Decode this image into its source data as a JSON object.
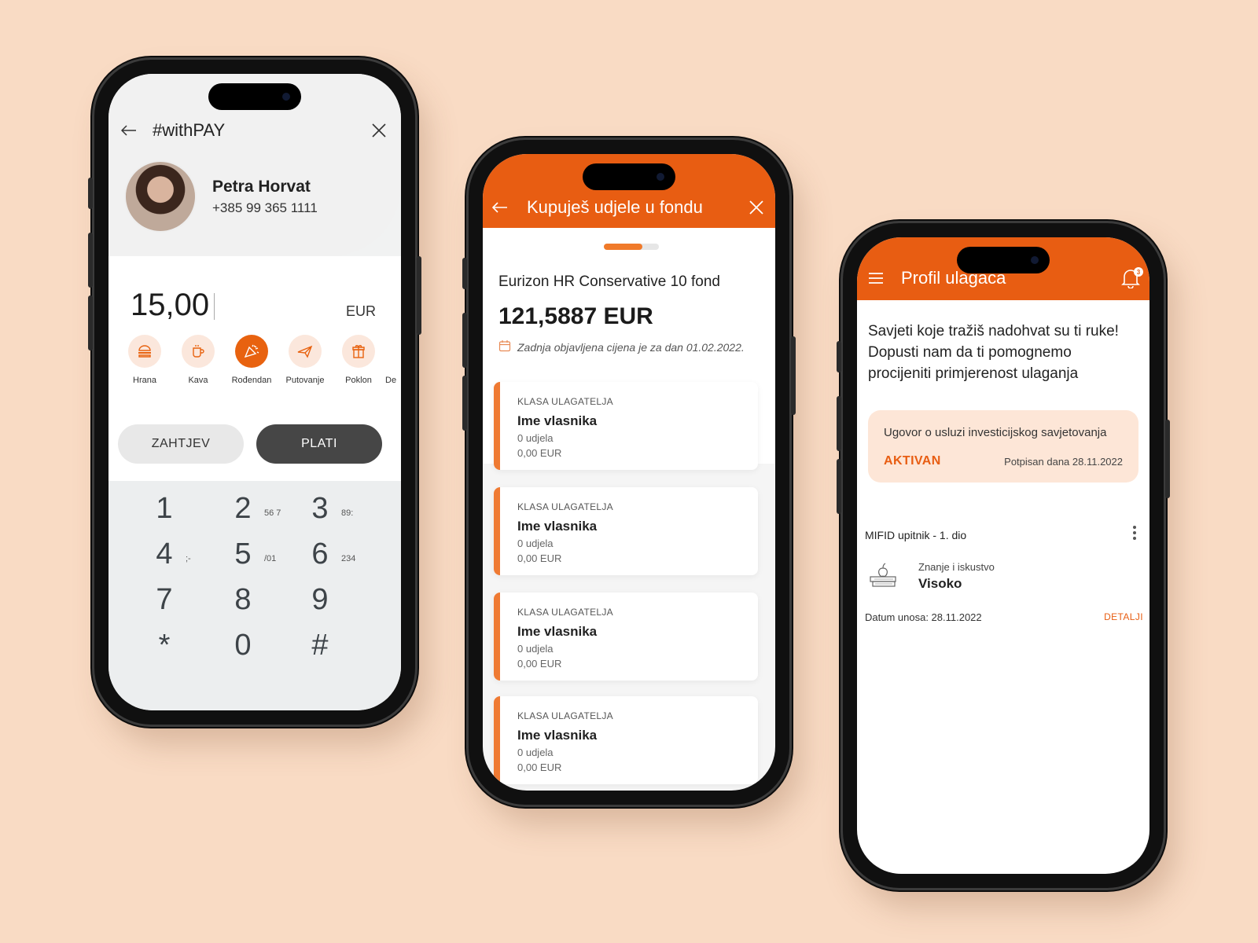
{
  "theme": {
    "accent": "#e85d12",
    "background": "#f9dbc4"
  },
  "phone1": {
    "title": "#withPAY",
    "back_icon": "arrow-left-icon",
    "close_icon": "close-icon",
    "contact": {
      "name": "Petra Horvat",
      "phone": "+385 99 365 1111"
    },
    "amount": "15,00",
    "currency": "EUR",
    "categories": [
      {
        "label": "Hrana",
        "icon": "food-icon",
        "active": false
      },
      {
        "label": "Kava",
        "icon": "coffee-icon",
        "active": false
      },
      {
        "label": "Rođendan",
        "icon": "party-icon",
        "active": true
      },
      {
        "label": "Putovanje",
        "icon": "plane-icon",
        "active": false
      },
      {
        "label": "Poklon",
        "icon": "gift-icon",
        "active": false
      },
      {
        "label": "De",
        "icon": "more-icon",
        "active": false
      }
    ],
    "request_label": "ZAHTJEV",
    "pay_label": "PLATI",
    "keys": [
      {
        "n": "1",
        "s": ""
      },
      {
        "n": "2",
        "s": "56 7"
      },
      {
        "n": "3",
        "s": "89:"
      },
      {
        "n": "4",
        "s": ";-"
      },
      {
        "n": "5",
        "s": "/01"
      },
      {
        "n": "6",
        "s": "234"
      },
      {
        "n": "7",
        "s": ""
      },
      {
        "n": "8",
        "s": ""
      },
      {
        "n": "9",
        "s": ""
      },
      {
        "n": "*",
        "s": ""
      },
      {
        "n": "0",
        "s": ""
      },
      {
        "n": "#",
        "s": ""
      }
    ]
  },
  "phone2": {
    "title": "Kupuješ udjele u fondu",
    "progress": 0.7,
    "fund_name": "Eurizon HR Conservative 10 fond",
    "fund_price": "121,5887 EUR",
    "price_date_note": "Zadnja objavljena cijena je za dan 01.02.2022.",
    "cards": [
      {
        "class_label": "KLASA ULAGATELJA",
        "owner": "Ime vlasnika",
        "units": "0 udjela",
        "value": "0,00 EUR"
      },
      {
        "class_label": "KLASA ULAGATELJA",
        "owner": "Ime vlasnika",
        "units": "0 udjela",
        "value": "0,00 EUR"
      },
      {
        "class_label": "KLASA ULAGATELJA",
        "owner": "Ime vlasnika",
        "units": "0 udjela",
        "value": "0,00 EUR"
      },
      {
        "class_label": "KLASA ULAGATELJA",
        "owner": "Ime vlasnika",
        "units": "0 udjela",
        "value": "0,00 EUR"
      }
    ]
  },
  "phone3": {
    "title": "Profil ulagača",
    "notification_count": "3",
    "advice": "Savjeti koje tražiš nadohvat su ti ruke! Dopusti nam da ti pomognemo procijeniti primjerenost ulaganja",
    "contract": {
      "title": "Ugovor o usluzi investicijskog savjetovanja",
      "status": "AKTIVAN",
      "signed": "Potpisan dana 28.11.2022"
    },
    "mifid_title": "MIFID upitnik - 1. dio",
    "knowledge_label": "Znanje i iskustvo",
    "knowledge_value": "Visoko",
    "entry_date": "Datum unosa: 28.11.2022",
    "details_label": "DETALJI"
  }
}
